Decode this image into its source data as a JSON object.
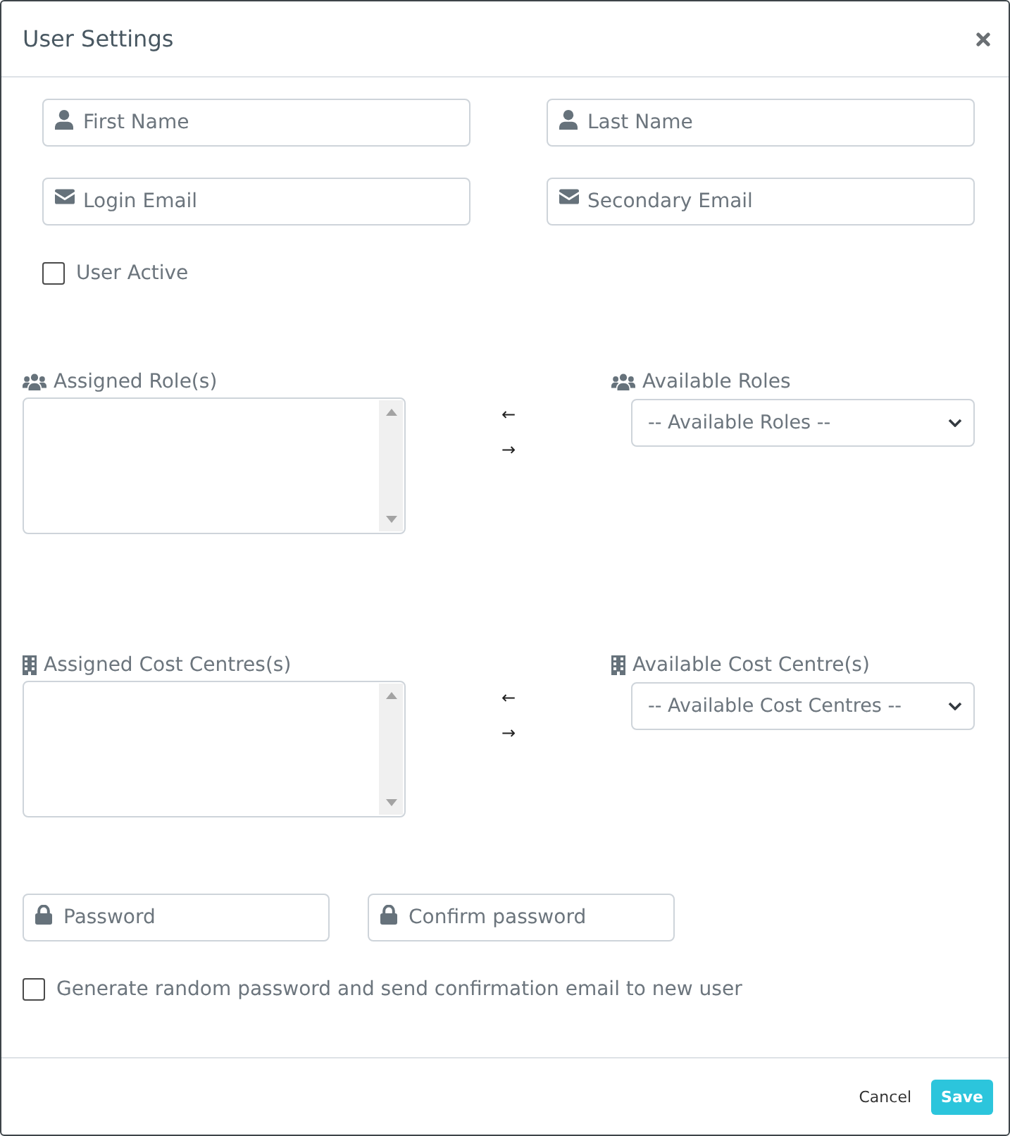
{
  "dialog": {
    "title": "User Settings"
  },
  "name_fields": [
    {
      "kind": "user",
      "placeholder": "First Name"
    },
    {
      "kind": "user",
      "placeholder": "Last Name"
    },
    {
      "kind": "email",
      "placeholder": "Login Email"
    },
    {
      "kind": "email",
      "placeholder": "Secondary Email"
    }
  ],
  "user_active": {
    "label": "User Active",
    "checked": false
  },
  "transfers": [
    {
      "kind": "roles",
      "assigned_label": "Assigned Role(s)",
      "move_left": "←",
      "move_right": "→",
      "available_label": "Available Roles",
      "available_select": "-- Available Roles --"
    },
    {
      "kind": "cost_centres",
      "assigned_label": "Assigned Cost Centres(s)",
      "move_left": "←",
      "move_right": "→",
      "available_label": "Available Cost Centre(s)",
      "available_select": "-- Available Cost Centres --"
    }
  ],
  "password_fields": [
    {
      "kind": "lock",
      "placeholder": "Password"
    },
    {
      "kind": "lock",
      "placeholder": "Confirm password"
    }
  ],
  "generate_password": {
    "label": "Generate random password and send confirmation email to new user",
    "checked": false
  },
  "footer": {
    "buttons": [
      {
        "kind": "cancel",
        "label": "Cancel"
      },
      {
        "kind": "save",
        "label": "Save"
      }
    ]
  }
}
